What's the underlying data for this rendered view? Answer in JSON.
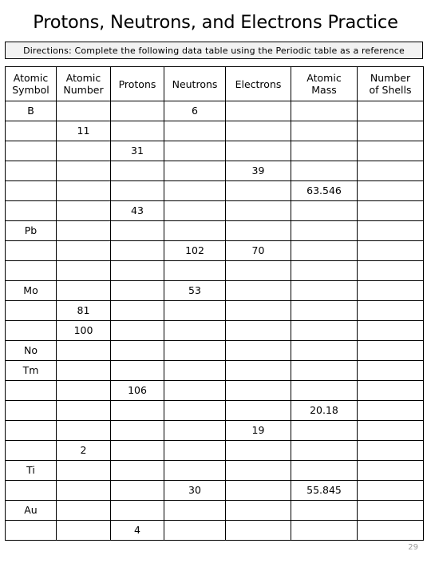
{
  "document": {
    "title": "Protons, Neutrons, and Electrons Practice",
    "directions": "Directions: Complete the following data table using the Periodic table as a reference",
    "page_number": "29"
  },
  "table": {
    "columns": [
      "Atomic Symbol",
      "Atomic Number",
      "Protons",
      "Neutrons",
      "Electrons",
      "Atomic Mass",
      "Number of Shells"
    ],
    "column_lines": [
      [
        "Atomic",
        "Symbol"
      ],
      [
        "Atomic",
        "Number"
      ],
      [
        "Protons",
        ""
      ],
      [
        "Neutrons",
        ""
      ],
      [
        "Electrons",
        ""
      ],
      [
        "Atomic",
        "Mass"
      ],
      [
        "Number",
        "of Shells"
      ]
    ],
    "rows": [
      {
        "symbol": "B",
        "number": "",
        "protons": "",
        "neutrons": "6",
        "electrons": "",
        "mass": "",
        "shells": ""
      },
      {
        "symbol": "",
        "number": "11",
        "protons": "",
        "neutrons": "",
        "electrons": "",
        "mass": "",
        "shells": ""
      },
      {
        "symbol": "",
        "number": "",
        "protons": "31",
        "neutrons": "",
        "electrons": "",
        "mass": "",
        "shells": ""
      },
      {
        "symbol": "",
        "number": "",
        "protons": "",
        "neutrons": "",
        "electrons": "39",
        "mass": "",
        "shells": ""
      },
      {
        "symbol": "",
        "number": "",
        "protons": "",
        "neutrons": "",
        "electrons": "",
        "mass": "63.546",
        "shells": ""
      },
      {
        "symbol": "",
        "number": "",
        "protons": "43",
        "neutrons": "",
        "electrons": "",
        "mass": "",
        "shells": ""
      },
      {
        "symbol": "Pb",
        "number": "",
        "protons": "",
        "neutrons": "",
        "electrons": "",
        "mass": "",
        "shells": ""
      },
      {
        "symbol": "",
        "number": "",
        "protons": "",
        "neutrons": "102",
        "electrons": "70",
        "mass": "",
        "shells": ""
      },
      {
        "symbol": "",
        "number": "",
        "protons": "",
        "neutrons": "",
        "electrons": "",
        "mass": "",
        "shells": ""
      },
      {
        "symbol": "Mo",
        "number": "",
        "protons": "",
        "neutrons": "53",
        "electrons": "",
        "mass": "",
        "shells": ""
      },
      {
        "symbol": "",
        "number": "81",
        "protons": "",
        "neutrons": "",
        "electrons": "",
        "mass": "",
        "shells": ""
      },
      {
        "symbol": "",
        "number": "100",
        "protons": "",
        "neutrons": "",
        "electrons": "",
        "mass": "",
        "shells": ""
      },
      {
        "symbol": "No",
        "number": "",
        "protons": "",
        "neutrons": "",
        "electrons": "",
        "mass": "",
        "shells": ""
      },
      {
        "symbol": "Tm",
        "number": "",
        "protons": "",
        "neutrons": "",
        "electrons": "",
        "mass": "",
        "shells": ""
      },
      {
        "symbol": "",
        "number": "",
        "protons": "106",
        "neutrons": "",
        "electrons": "",
        "mass": "",
        "shells": ""
      },
      {
        "symbol": "",
        "number": "",
        "protons": "",
        "neutrons": "",
        "electrons": "",
        "mass": "20.18",
        "shells": ""
      },
      {
        "symbol": "",
        "number": "",
        "protons": "",
        "neutrons": "",
        "electrons": "19",
        "mass": "",
        "shells": ""
      },
      {
        "symbol": "",
        "number": "2",
        "protons": "",
        "neutrons": "",
        "electrons": "",
        "mass": "",
        "shells": ""
      },
      {
        "symbol": "Ti",
        "number": "",
        "protons": "",
        "neutrons": "",
        "electrons": "",
        "mass": "",
        "shells": ""
      },
      {
        "symbol": "",
        "number": "",
        "protons": "",
        "neutrons": "30",
        "electrons": "",
        "mass": "55.845",
        "shells": ""
      },
      {
        "symbol": "Au",
        "number": "",
        "protons": "",
        "neutrons": "",
        "electrons": "",
        "mass": "",
        "shells": ""
      },
      {
        "symbol": "",
        "number": "",
        "protons": "4",
        "neutrons": "",
        "electrons": "",
        "mass": "",
        "shells": ""
      }
    ]
  },
  "colors": {
    "border": "#000000",
    "directions_fill": "#f2f2f2",
    "page_number": "#9a9a9a",
    "text": "#000000"
  }
}
